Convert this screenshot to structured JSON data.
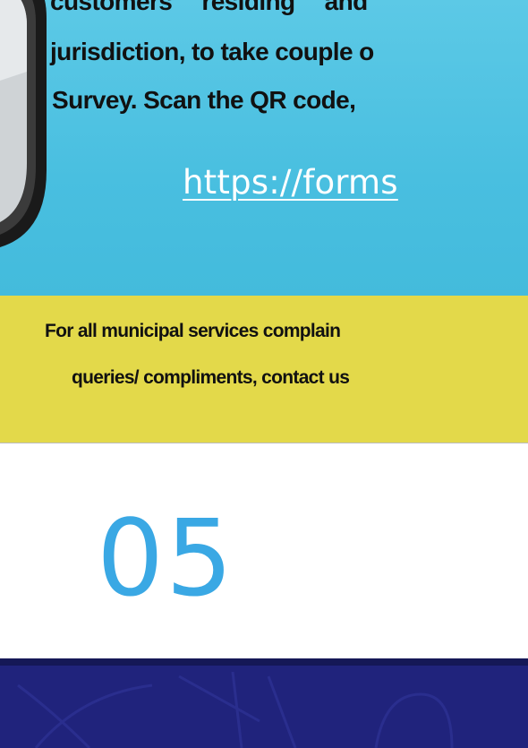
{
  "hero": {
    "line0": "customers residing and",
    "line1": "jurisdiction, to take couple o",
    "line2": "Survey. Scan the QR code,",
    "link": "https://forms"
  },
  "banner": {
    "line1": "For all municipal services complain",
    "line2": "queries/ compliments, contact us"
  },
  "section": {
    "number": "05"
  },
  "colors": {
    "hero_bg": "#4cc2e2",
    "banner_bg": "#e3d94a",
    "number": "#3aa8e4",
    "footer_bg": "#20237c"
  }
}
